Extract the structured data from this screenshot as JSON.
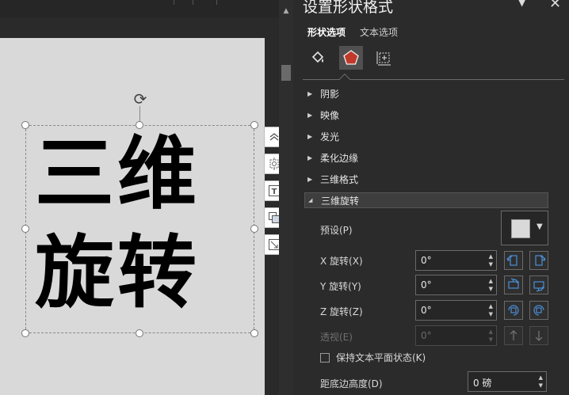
{
  "pane": {
    "title": "设置形状格式",
    "tabs": {
      "shape_options": "形状选项",
      "text_options": "文本选项"
    },
    "categories": [
      "fill-line-icon",
      "effects-icon",
      "size-properties-icon"
    ],
    "sections": {
      "shadow": "阴影",
      "reflection": "映像",
      "glow": "发光",
      "soft_edges": "柔化边缘",
      "format_3d": "三维格式",
      "rotation_3d": "三维旋转"
    },
    "rotation": {
      "preset_label": "预设(P)",
      "x_label": "X 旋转(X)",
      "x_value": "0°",
      "y_label": "Y 旋转(Y)",
      "y_value": "0°",
      "z_label": "Z 旋转(Z)",
      "z_value": "0°",
      "perspective_label": "透视(E)",
      "perspective_value": "0°",
      "keep_text_flat_label": "保持文本平面状态(K)",
      "keep_text_flat_checked": false,
      "distance_label": "距底边高度(D)",
      "distance_value": "0 磅"
    }
  },
  "slide": {
    "line1": "三维",
    "line2": "旋转"
  },
  "quick_tools": [
    "layout-options-icon",
    "animation-anchor-icon",
    "text-box-icon",
    "arrange-icon",
    "resize-icon"
  ],
  "colors": {
    "pane_bg": "#2b2b2b",
    "slide_bg": "#d9d9d9",
    "accent_blue": "#4a8fd6",
    "effects_icon_red": "#c0392b"
  }
}
